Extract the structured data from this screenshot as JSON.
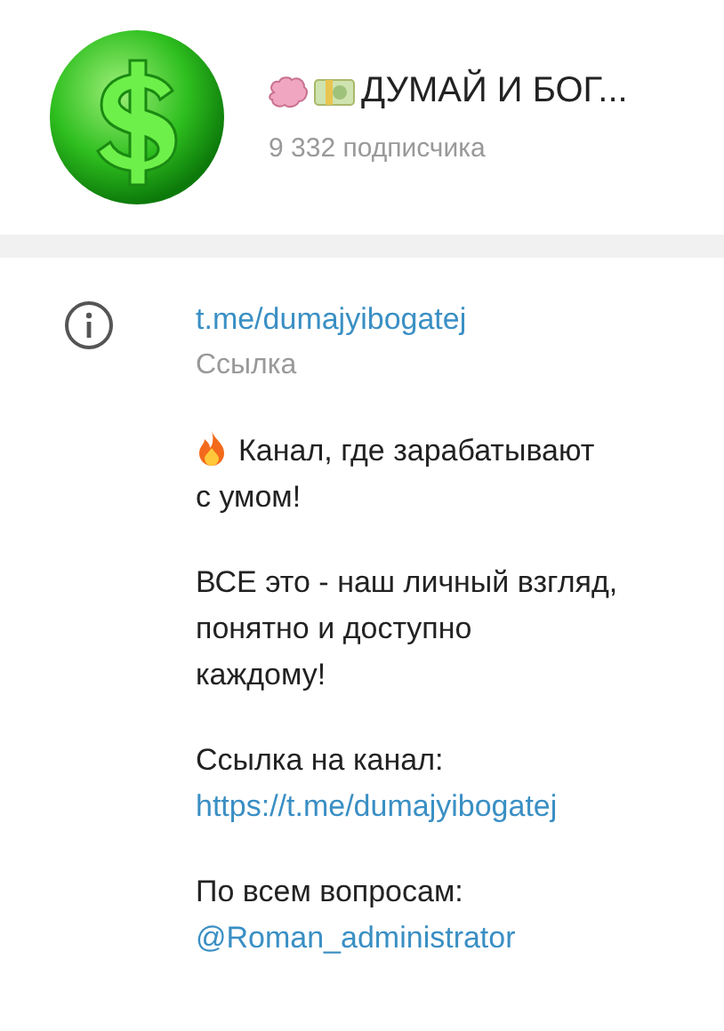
{
  "channel": {
    "title": "ДУМАЙ И БОГ...",
    "subscribers": "9 332 подписчика"
  },
  "info": {
    "link": "t.me/dumajyibogatej",
    "link_caption": "Ссылка",
    "description": [
      {
        "kind": "text",
        "lines": [
          "Канал, где зарабатывают",
          "с умом!"
        ],
        "icon": true
      },
      {
        "kind": "text",
        "lines": [
          "ВСЕ это - наш личный взгляд,",
          "понятно и доступно",
          "каждому!"
        ]
      },
      {
        "kind": "text",
        "lines": [
          "Ссылка на канал:"
        ]
      },
      {
        "kind": "link",
        "lines": [
          "https://t.me/dumajyibogatej"
        ]
      },
      {
        "kind": "text",
        "lines": [
          "По всем вопросам:"
        ]
      },
      {
        "kind": "link",
        "lines": [
          "@Roman_administrator"
        ]
      }
    ]
  }
}
